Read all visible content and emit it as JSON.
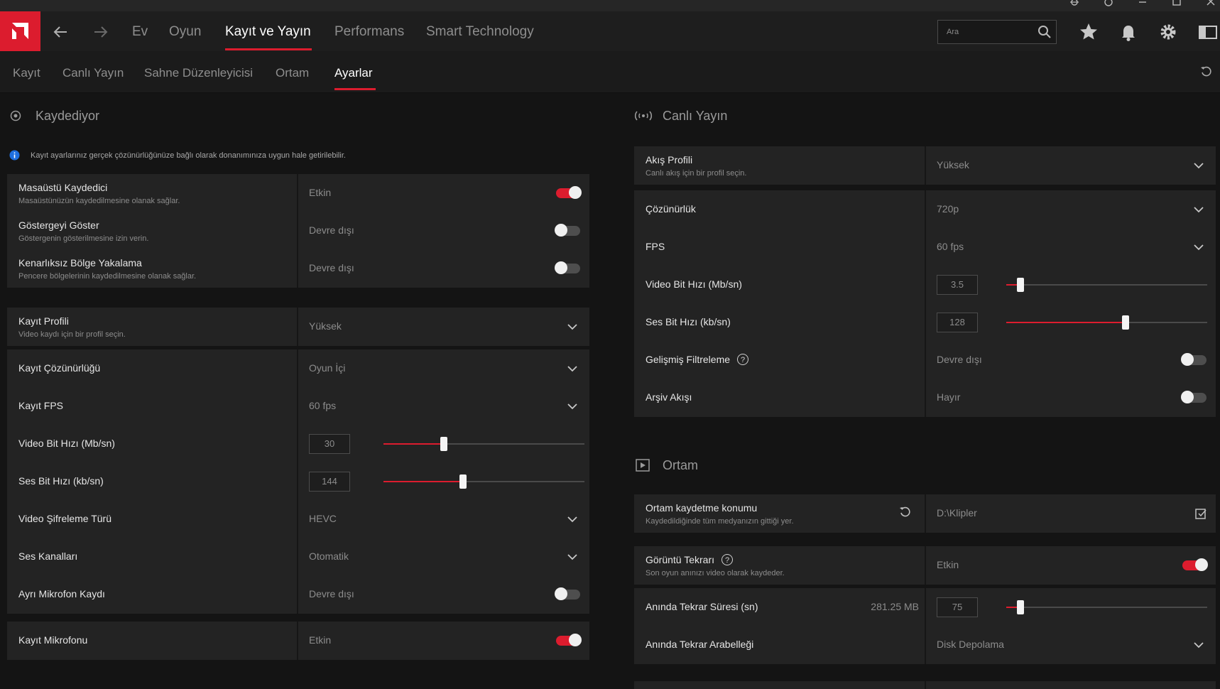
{
  "window": {
    "buttons": [
      "bug-icon",
      "help-icon",
      "minimize-icon",
      "maximize-icon",
      "close-icon"
    ]
  },
  "topnav": {
    "tabs": [
      {
        "label": "Ev"
      },
      {
        "label": "Oyun"
      },
      {
        "label": "Kayıt ve Yayın",
        "active": true
      },
      {
        "label": "Performans"
      },
      {
        "label": "Smart Technology"
      }
    ],
    "search_placeholder": "Ara"
  },
  "subnav": {
    "tabs": [
      {
        "label": "Kayıt"
      },
      {
        "label": "Canlı Yayın"
      },
      {
        "label": "Sahne Düzenleyicisi"
      },
      {
        "label": "Ortam"
      },
      {
        "label": "Ayarlar",
        "active": true
      }
    ]
  },
  "left": {
    "section_title": "Kaydediyor",
    "info": "Kayıt ayarlarınız gerçek çözünürlüğünüze bağlı olarak donanımınıza uygun hale getirilebilir.",
    "rows": [
      {
        "label": "Masaüstü Kaydedici",
        "desc": "Masaüstünüzün kaydedilmesine olanak sağlar.",
        "value": "Etkin",
        "control": "toggle",
        "on": true
      },
      {
        "label": "Göstergeyi Göster",
        "desc": "Göstergenin gösterilmesine izin verin.",
        "value": "Devre dışı",
        "control": "toggle",
        "on": false
      },
      {
        "label": "Kenarlıksız Bölge Yakalama",
        "desc": "Pencere bölgelerinin kaydedilmesine olanak sağlar.",
        "value": "Devre dışı",
        "control": "toggle",
        "on": false
      },
      {
        "label": "Kayıt Profili",
        "desc": "Video kaydı için bir profil seçin.",
        "value": "Yüksek",
        "control": "dropdown"
      },
      {
        "label": "Kayıt Çözünürlüğü",
        "value": "Oyun İçi",
        "control": "dropdown"
      },
      {
        "label": "Kayıt FPS",
        "value": "60 fps",
        "control": "dropdown"
      },
      {
        "label": "Video Bit Hızı (Mb/sn)",
        "value": "30",
        "control": "slider",
        "level": 0.3
      },
      {
        "label": "Ses Bit Hızı (kb/sn)",
        "value": "144",
        "control": "slider",
        "level": 0.395
      },
      {
        "label": "Video Şifreleme Türü",
        "value": "HEVC",
        "control": "dropdown"
      },
      {
        "label": "Ses Kanalları",
        "value": "Otomatik",
        "control": "dropdown"
      },
      {
        "label": "Ayrı Mikrofon Kaydı",
        "value": "Devre dışı",
        "control": "toggle",
        "on": false
      },
      {
        "label": "Kayıt Mikrofonu",
        "value": "Etkin",
        "control": "toggle",
        "on": true
      }
    ]
  },
  "right": {
    "stream_title": "Canlı Yayın",
    "stream_rows": [
      {
        "label": "Akış Profili",
        "desc": "Canlı akış için bir profil seçin.",
        "value": "Yüksek",
        "control": "dropdown"
      },
      {
        "label": "Çözünürlük",
        "value": "720p",
        "control": "dropdown"
      },
      {
        "label": "FPS",
        "value": "60 fps",
        "control": "dropdown"
      },
      {
        "label": "Video Bit Hızı (Mb/sn)",
        "value": "3.5",
        "control": "slider",
        "level": 0.07
      },
      {
        "label": "Ses Bit Hızı (kb/sn)",
        "value": "128",
        "control": "slider",
        "level": 0.595
      },
      {
        "label": "Gelişmiş Filtreleme",
        "value": "Devre dışı",
        "control": "toggle",
        "on": false,
        "help": "?"
      },
      {
        "label": "Arşiv Akışı",
        "value": "Hayır",
        "control": "toggle",
        "on": false
      }
    ],
    "media_title": "Ortam",
    "media_rows": [
      {
        "label": "Ortam kaydetme konumu",
        "desc": "Kaydedildiğinde tüm medyanızın gittiği yer.",
        "value": "D:\\Klipler",
        "control": "folder"
      },
      {
        "label": "Görüntü Tekrarı",
        "desc": "Son oyun anınızı video olarak kaydeder.",
        "value": "Etkin",
        "control": "toggle",
        "on": true,
        "help": "?"
      },
      {
        "label": "Anında Tekrar Süresi (sn)",
        "size": "281.25 MB",
        "value": "75",
        "control": "slider",
        "level": 0.07
      },
      {
        "label": "Anında Tekrar Arabelleği",
        "value": "Disk Depolama",
        "control": "dropdown"
      }
    ]
  },
  "colors": {
    "accent": "#dc1c2e",
    "row_bg": "#232323",
    "page_bg": "#141414"
  }
}
